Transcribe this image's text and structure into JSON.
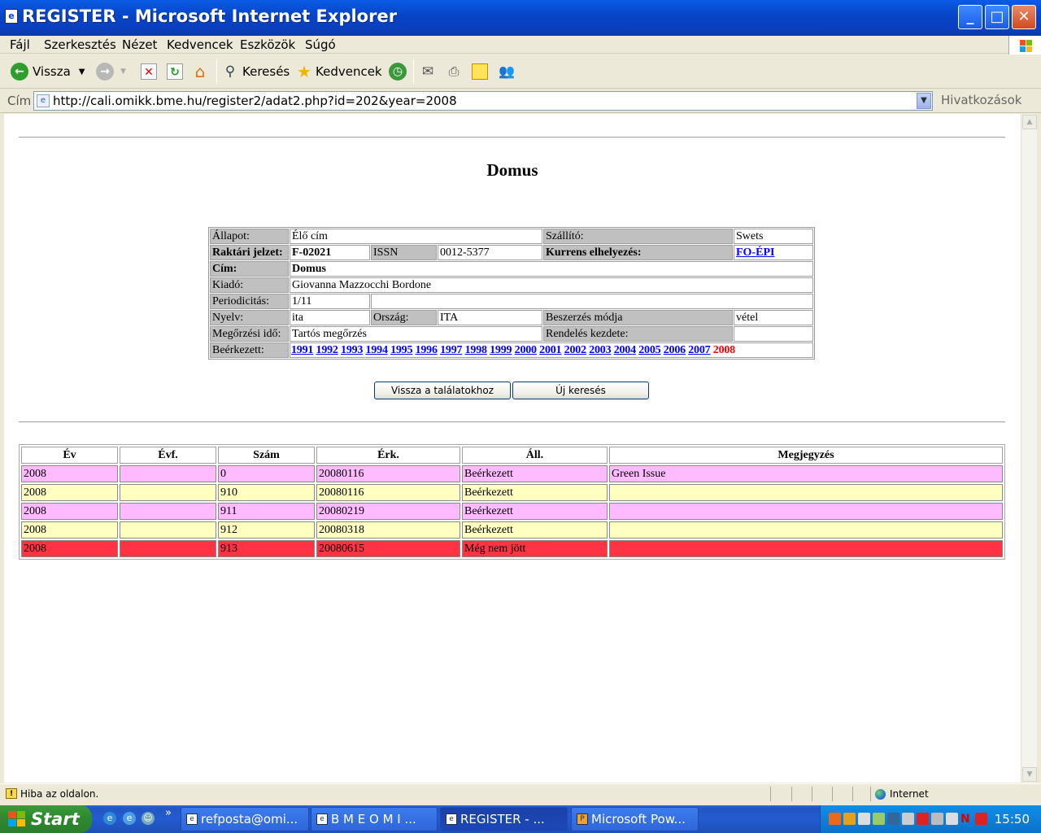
{
  "window": {
    "title": "REGISTER - Microsoft Internet Explorer",
    "min_glyph": "_",
    "max_glyph": "□",
    "close_glyph": "✕"
  },
  "menu": [
    "Fájl",
    "Szerkesztés",
    "Nézet",
    "Kedvencek",
    "Eszközök",
    "Súgó"
  ],
  "toolbar": {
    "back_label": "Vissza",
    "search_label": "Keresés",
    "favorites_label": "Kedvencek"
  },
  "address": {
    "label": "Cím",
    "url": "http://cali.omikk.bme.hu/register2/adat2.php?id=202&year=2008",
    "links_label": "Hivatkozások"
  },
  "page": {
    "title": "Domus",
    "info": {
      "allapot_label": "Állapot:",
      "allapot_value": "Élő cím",
      "szallito_label": "Szállító:",
      "szallito_value": "Swets",
      "raktari_label": "Raktári jelzet:",
      "raktari_value": "F-02021",
      "issn_label": "ISSN",
      "issn_value": "0012-5377",
      "kurrens_label": "Kurrens elhelyezés:",
      "kurrens_value": "FO-ÉPI",
      "cim_label": "Cím:",
      "cim_value": "Domus",
      "kiado_label": "Kiadó:",
      "kiado_value": "Giovanna Mazzocchi Bordone",
      "periodicitas_label": "Periodicitás:",
      "periodicitas_value": "1/11",
      "nyelv_label": "Nyelv:",
      "nyelv_value": "ita",
      "orszag_label": "Ország:",
      "orszag_value": "ITA",
      "beszerzes_label": "Beszerzés módja",
      "beszerzes_value": "vétel",
      "megorzesi_label": "Megőrzési idő:",
      "megorzesi_value": "Tartós megőrzés",
      "rendeles_label": "Rendelés kezdete:",
      "rendeles_value": "",
      "beerkezett_label": "Beérkezett:",
      "years": [
        "1991",
        "1992",
        "1993",
        "1994",
        "1995",
        "1996",
        "1997",
        "1998",
        "1999",
        "2000",
        "2001",
        "2002",
        "2003",
        "2004",
        "2005",
        "2006",
        "2007"
      ],
      "current_year": "2008"
    },
    "buttons": {
      "back": "Vissza a találatokhoz",
      "new_search": "Új keresés"
    },
    "issues": {
      "headers": [
        "Év",
        "Évf.",
        "Szám",
        "Érk.",
        "Áll.",
        "Megjegyzés"
      ],
      "rows": [
        {
          "ev": "2008",
          "evf": "",
          "szam": "0",
          "erk": "20080116",
          "all": "Beérkezett",
          "megj": "Green Issue"
        },
        {
          "ev": "2008",
          "evf": "",
          "szam": "910",
          "erk": "20080116",
          "all": "Beérkezett",
          "megj": ""
        },
        {
          "ev": "2008",
          "evf": "",
          "szam": "911",
          "erk": "20080219",
          "all": "Beérkezett",
          "megj": ""
        },
        {
          "ev": "2008",
          "evf": "",
          "szam": "912",
          "erk": "20080318",
          "all": "Beérkezett",
          "megj": ""
        },
        {
          "ev": "2008",
          "evf": "",
          "szam": "913",
          "erk": "20080615",
          "all": "Még nem jött",
          "megj": ""
        }
      ]
    }
  },
  "status": {
    "message": "Hiba az oldalon.",
    "zone": "Internet"
  },
  "taskbar": {
    "start_label": "Start",
    "tasks": [
      "refposta@omi...",
      "B M E  O M I ...",
      "REGISTER - ...",
      "Microsoft Pow..."
    ],
    "overflow_glyph": "»",
    "clock": "15:50"
  }
}
